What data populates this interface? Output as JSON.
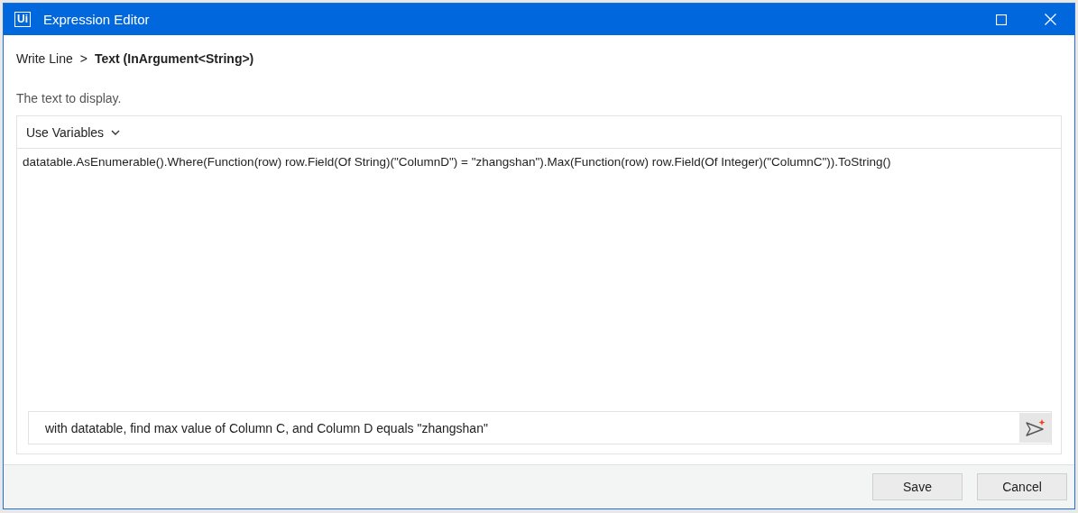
{
  "window": {
    "title": "Expression Editor",
    "logo": "Ui"
  },
  "breadcrumb": {
    "parent": "Write Line",
    "separator": ">",
    "current": "Text (InArgument<String>)"
  },
  "description": "The text to display.",
  "editor": {
    "toolbar_button": "Use Variables",
    "code": "datatable.AsEnumerable().Where(Function(row) row.Field(Of String)(\"ColumnD\") = \"zhangshan\").Max(Function(row) row.Field(Of Integer)(\"ColumnC\")).ToString()"
  },
  "prompt": {
    "value": "with datatable, find max value of Column C, and Column D equals \"zhangshan\""
  },
  "buttons": [
    {
      "label": "Save"
    },
    {
      "label": "Cancel"
    }
  ]
}
